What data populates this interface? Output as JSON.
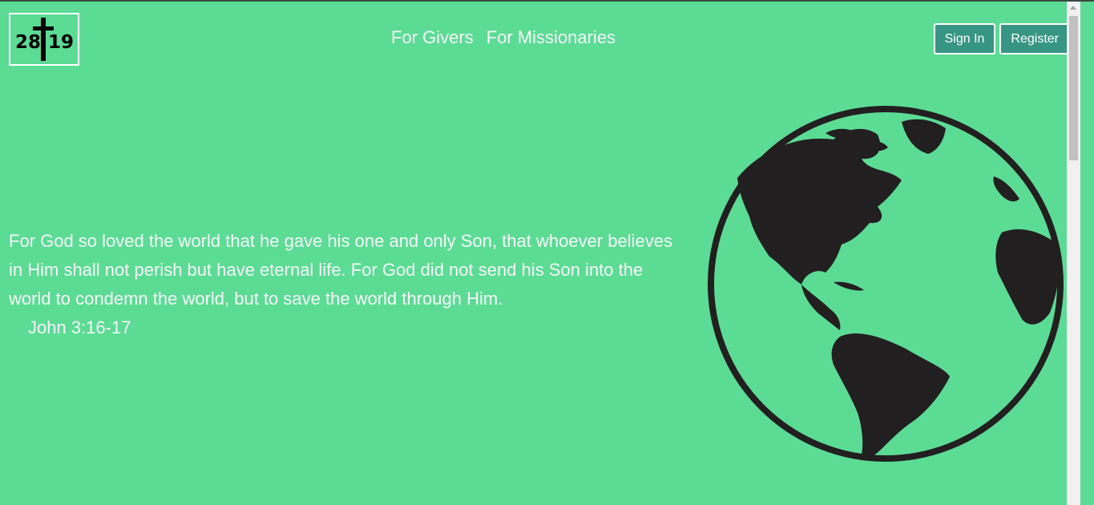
{
  "header": {
    "logo_text_left": "28",
    "logo_text_right": "19",
    "nav": [
      {
        "label": "For Givers"
      },
      {
        "label": "For Missionaries"
      }
    ],
    "sign_in_label": "Sign In",
    "register_label": "Register"
  },
  "hero": {
    "verse": "For God so loved the world that he gave his one and only Son, that whoever believes in Him shall not perish but have eternal life. For God did not send his Son into the world to condemn the world, but to save the world through Him.",
    "reference": "John 3:16-17",
    "image_icon": "globe-icon"
  },
  "colors": {
    "background": "#5cdb95",
    "button": "#379683",
    "text": "#f4fbf6",
    "globe": "#221f20"
  }
}
